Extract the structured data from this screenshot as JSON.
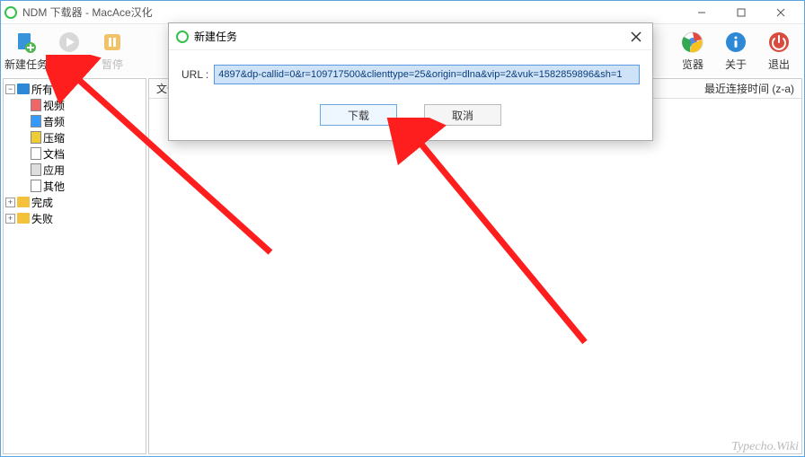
{
  "window": {
    "title": "NDM 下载器 - MacAce汉化"
  },
  "toolbar": {
    "new_task": "新建任务",
    "resume": "恢复",
    "pause": "暂停",
    "browser": "览器",
    "about": "关于",
    "exit": "退出"
  },
  "tree": {
    "all": "所有",
    "video": "视频",
    "audio": "音频",
    "archive": "压缩",
    "document": "文档",
    "app": "应用",
    "other": "其他",
    "done": "完成",
    "failed": "失败"
  },
  "list": {
    "col_file": "文件",
    "col_time": "最近连接时间 (z-a)"
  },
  "dialog": {
    "title": "新建任务",
    "url_label": "URL :",
    "url_value": "4897&dp-callid=0&r=109717500&clienttype=25&origin=dlna&vip=2&vuk=1582859896&sh=1",
    "download": "下载",
    "cancel": "取消"
  },
  "watermark": "Typecho.Wiki"
}
